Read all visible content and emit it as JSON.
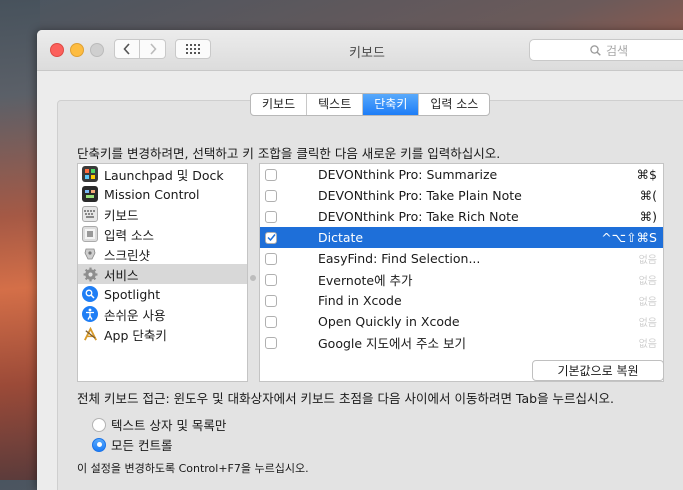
{
  "window": {
    "title": "키보드"
  },
  "search": {
    "placeholder": "검색"
  },
  "tabs": [
    {
      "label": "키보드"
    },
    {
      "label": "텍스트"
    },
    {
      "label": "단축키",
      "active": true
    },
    {
      "label": "입력 소스"
    }
  ],
  "instruction": "단축키를 변경하려면, 선택하고 키 조합을 클릭한 다음 새로운 키를 입력하십시오.",
  "categories": [
    {
      "label": "Launchpad 및 Dock",
      "icon": "launchpad-icon"
    },
    {
      "label": "Mission Control",
      "icon": "mission-control-icon"
    },
    {
      "label": "키보드",
      "icon": "keyboard-icon"
    },
    {
      "label": "입력 소스",
      "icon": "input-sources-icon"
    },
    {
      "label": "스크린샷",
      "icon": "screenshot-icon"
    },
    {
      "label": "서비스",
      "icon": "services-gear-icon",
      "selected": true
    },
    {
      "label": "Spotlight",
      "icon": "spotlight-icon"
    },
    {
      "label": "손쉬운 사용",
      "icon": "accessibility-icon"
    },
    {
      "label": "App 단축키",
      "icon": "app-shortcuts-icon"
    }
  ],
  "shortcuts": [
    {
      "name": "DEVONthink Pro: Summarize",
      "key": "⌘$",
      "checked": false
    },
    {
      "name": "DEVONthink Pro: Take Plain Note",
      "key": "⌘(",
      "checked": false
    },
    {
      "name": "DEVONthink Pro: Take Rich Note",
      "key": "⌘)",
      "checked": false
    },
    {
      "name": "Dictate",
      "key": "^⌥⇧⌘S",
      "checked": true,
      "selected": true
    },
    {
      "name": "EasyFind: Find Selection...",
      "key": "없음",
      "checked": false
    },
    {
      "name": "Evernote에 추가",
      "key": "없음",
      "checked": false
    },
    {
      "name": "Find in Xcode",
      "key": "없음",
      "checked": false
    },
    {
      "name": "Open Quickly in Xcode",
      "key": "없음",
      "checked": false
    },
    {
      "name": "Google 지도에서 주소 보기",
      "key": "없음",
      "checked": false
    }
  ],
  "restore_button": "기본값으로 복원",
  "keyboard_access": {
    "label": "전체 키보드 접근: 윈도우 및 대화상자에서 키보드 초점을 다음 사이에서 이동하려면 Tab을 누르십시오.",
    "options": [
      {
        "label": "텍스트 상자 및 목록만",
        "selected": false
      },
      {
        "label": "모든 컨트롤",
        "selected": true
      }
    ],
    "note": "이 설정을 변경하도록 Control+F7을 누르십시오."
  },
  "colors": {
    "selection": "#1e6fd9",
    "accent": "#1d7df7"
  }
}
